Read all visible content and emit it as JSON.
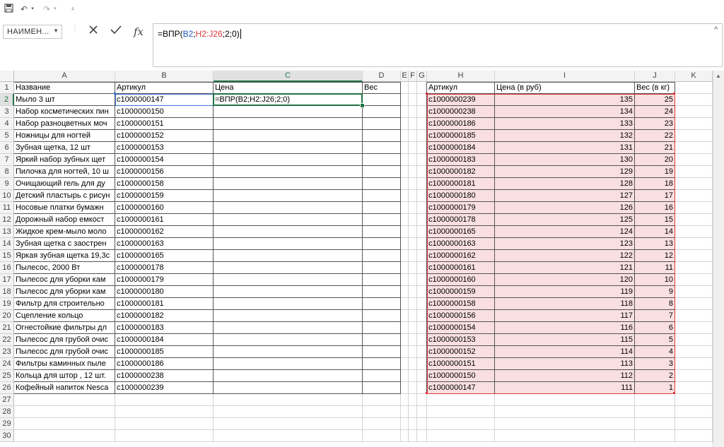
{
  "qat": {
    "save_icon": "save-icon",
    "undo_icon": "undo-icon",
    "redo_icon": "redo-icon",
    "customize_icon": "customize-icon"
  },
  "formula_bar": {
    "name_box": "НАИМЕН...",
    "formula_prefix": "=ВПР(",
    "formula_ref1": "B2",
    "formula_sep1": ";",
    "formula_ref2": "H2:J26",
    "formula_suffix": ";2;0)"
  },
  "columns": [
    "A",
    "B",
    "C",
    "D",
    "E",
    "F",
    "G",
    "H",
    "I",
    "J",
    "K"
  ],
  "rows": [
    "1",
    "2",
    "3",
    "4",
    "5",
    "6",
    "7",
    "8",
    "9",
    "10",
    "11",
    "12",
    "13",
    "14",
    "15",
    "16",
    "17",
    "18",
    "19",
    "20",
    "21",
    "22",
    "23",
    "24",
    "25",
    "26",
    "27",
    "28",
    "29",
    "30"
  ],
  "headers": {
    "a": "Название",
    "b": "Артикул",
    "c": "Цена",
    "d": "Вес",
    "h": "Артикул",
    "i": "Цена (в руб)",
    "j": "Вес (в кг)"
  },
  "active_cell_text": "=ВПР(B2;H2:J26;2;0)",
  "left_table": [
    [
      "Мыло 3 шт",
      "c1000000147"
    ],
    [
      "Набор косметических пин",
      "c1000000150"
    ],
    [
      "Набор разноцветных моч",
      "c1000000151"
    ],
    [
      "Ножницы для ногтей",
      "c1000000152"
    ],
    [
      "Зубная щетка, 12 шт",
      "c1000000153"
    ],
    [
      "Яркий набор зубных щет",
      "c1000000154"
    ],
    [
      "Пилочка для ногтей, 10 ш",
      "c1000000156"
    ],
    [
      "Очищающий гель для ду",
      "c1000000158"
    ],
    [
      "Детский пластырь с рисун",
      "c1000000159"
    ],
    [
      "Носовые платки бумажн",
      "c1000000160"
    ],
    [
      "Дорожный набор емкост",
      "c1000000161"
    ],
    [
      "Жидкое крем-мыло моло",
      "c1000000162"
    ],
    [
      "Зубная щетка с заострен",
      "c1000000163"
    ],
    [
      "Яркая зубная щетка 19,3с",
      "c1000000165"
    ],
    [
      "Пылесос, 2000 Вт",
      "c1000000178"
    ],
    [
      "Пылесос для уборки кам",
      "c1000000179"
    ],
    [
      "Пылесос для уборки кам",
      "c1000000180"
    ],
    [
      "Фильтр для строительно",
      "c1000000181"
    ],
    [
      "Сцепление кольцо",
      "c1000000182"
    ],
    [
      "Огнестойкие фильтры дл",
      "c1000000183"
    ],
    [
      "Пылесос для грубой очис",
      "c1000000184"
    ],
    [
      "Пылесос для грубой очис",
      "c1000000185"
    ],
    [
      "Фильтры каминных пыле",
      "c1000000186"
    ],
    [
      "Кольца для штор  , 12 шт.",
      "c1000000238"
    ],
    [
      "Кофейный напиток Nesca",
      "c1000000239"
    ]
  ],
  "right_table": [
    [
      "c1000000239",
      "135",
      "25"
    ],
    [
      "c1000000238",
      "134",
      "24"
    ],
    [
      "c1000000186",
      "133",
      "23"
    ],
    [
      "c1000000185",
      "132",
      "22"
    ],
    [
      "c1000000184",
      "131",
      "21"
    ],
    [
      "c1000000183",
      "130",
      "20"
    ],
    [
      "c1000000182",
      "129",
      "19"
    ],
    [
      "c1000000181",
      "128",
      "18"
    ],
    [
      "c1000000180",
      "127",
      "17"
    ],
    [
      "c1000000179",
      "126",
      "16"
    ],
    [
      "c1000000178",
      "125",
      "15"
    ],
    [
      "c1000000165",
      "124",
      "14"
    ],
    [
      "c1000000163",
      "123",
      "13"
    ],
    [
      "c1000000162",
      "122",
      "12"
    ],
    [
      "c1000000161",
      "121",
      "11"
    ],
    [
      "c1000000160",
      "120",
      "10"
    ],
    [
      "c1000000159",
      "119",
      "9"
    ],
    [
      "c1000000158",
      "118",
      "8"
    ],
    [
      "c1000000156",
      "117",
      "7"
    ],
    [
      "c1000000154",
      "116",
      "6"
    ],
    [
      "c1000000153",
      "115",
      "5"
    ],
    [
      "c1000000152",
      "114",
      "4"
    ],
    [
      "c1000000151",
      "113",
      "3"
    ],
    [
      "c1000000150",
      "112",
      "2"
    ],
    [
      "c1000000147",
      "111",
      "1"
    ]
  ],
  "colors": {
    "accent": "#217346",
    "ref_blue": "#3c78d8",
    "ref_red": "#e0363b",
    "range_fill": "#f9dfe0"
  }
}
